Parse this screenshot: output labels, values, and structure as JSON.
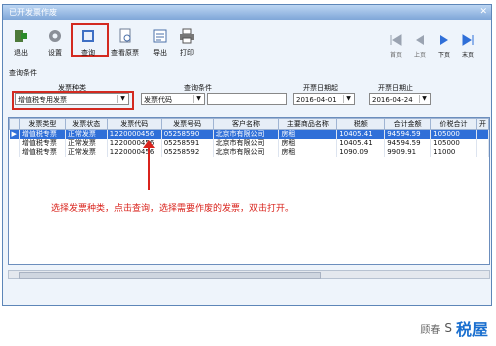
{
  "window": {
    "title": "已开发票作废",
    "close_label": "✕"
  },
  "toolbar": {
    "items": [
      {
        "label": "退出",
        "icon": "exit-icon"
      },
      {
        "label": "设置",
        "icon": "gear-icon"
      },
      {
        "label": "查询",
        "icon": "query-icon"
      },
      {
        "label": "查看原票",
        "icon": "view-invoice-icon"
      },
      {
        "label": "导出",
        "icon": "export-icon"
      },
      {
        "label": "打印",
        "icon": "printer-icon"
      }
    ],
    "nav": [
      {
        "label": "首页",
        "icon": "first-page-icon"
      },
      {
        "label": "上页",
        "icon": "prev-page-icon"
      },
      {
        "label": "下页",
        "icon": "next-page-icon"
      },
      {
        "label": "末页",
        "icon": "last-page-icon"
      }
    ],
    "section_label": "查询条件"
  },
  "filters": {
    "invoice_type_label": "发票种类",
    "invoice_type_value": "增值税专用发票",
    "condition_label": "查询条件",
    "condition_field_value": "发票代码",
    "condition_text_value": "",
    "start_date_label": "开票日期起",
    "start_date_value": "2016-04-01",
    "end_date_label": "开票日期止",
    "end_date_value": "2016-04-24"
  },
  "table": {
    "columns": [
      "发票类型",
      "发票状态",
      "发票代码",
      "发票号码",
      "客户名称",
      "主要商品名称",
      "税额",
      "合计金额",
      "价税合计",
      "开"
    ],
    "rows": [
      [
        "增值税专票",
        "正常发票",
        "1220000456",
        "05258590",
        "北京市有限公司",
        "房租",
        "10405.41",
        "94594.59",
        "105000",
        ""
      ],
      [
        "增值税专票",
        "正常发票",
        "1220000456",
        "05258591",
        "北京市有限公司",
        "房租",
        "10405.41",
        "94594.59",
        "105000",
        ""
      ],
      [
        "增值税专票",
        "正常发票",
        "1220000456",
        "05258592",
        "北京市有限公司",
        "房租",
        "1090.09",
        "9909.91",
        "11000",
        ""
      ]
    ]
  },
  "annotation": {
    "text": "选择发票种类，点击查询，选择需要作废的发票，双击打开。"
  },
  "watermark": {
    "a": "顾春",
    "b": "S",
    "c": "税屋"
  },
  "colors": {
    "highlight": "#d32a20",
    "selected_row": "#2f6fd8"
  }
}
